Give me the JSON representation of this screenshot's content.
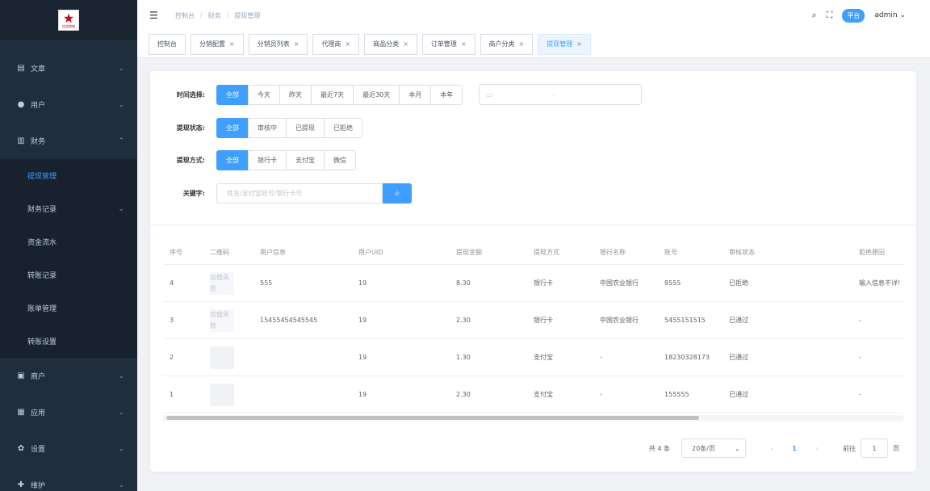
{
  "sidebar": {
    "logo_icon": "star-logo-icon",
    "logo_text": "优选商城",
    "items": [
      {
        "label": "文章",
        "icon": "document-icon"
      },
      {
        "label": "用户",
        "icon": "user-icon"
      },
      {
        "label": "财务",
        "icon": "chart-icon"
      },
      {
        "label": "商户",
        "icon": "shop-icon"
      },
      {
        "label": "应用",
        "icon": "app-icon"
      },
      {
        "label": "设置",
        "icon": "gear-icon"
      },
      {
        "label": "维护",
        "icon": "maintenance-icon"
      }
    ],
    "finance_sub": [
      "提现管理",
      "财务记录",
      "资金流水",
      "转账记录",
      "账单管理",
      "转账设置"
    ],
    "active_sub": "提现管理"
  },
  "header": {
    "breadcrumb": [
      "控制台",
      "财务",
      "提现管理"
    ],
    "platform_badge": "平台",
    "user": "admin"
  },
  "tags": [
    "控制台",
    "分销配置",
    "分销员列表",
    "代理商",
    "商品分类",
    "订单管理",
    "商户分类",
    "提现管理"
  ],
  "filters": {
    "time_label": "时间选择:",
    "time_options": [
      "全部",
      "今天",
      "昨天",
      "最近7天",
      "最近30天",
      "本月",
      "本年"
    ],
    "status_label": "提现状态:",
    "status_options": [
      "全部",
      "审核中",
      "已提现",
      "已拒绝"
    ],
    "method_label": "提现方式:",
    "method_options": [
      "全部",
      "银行卡",
      "支付宝",
      "微信"
    ],
    "keyword_label": "关键字:",
    "keyword_placeholder": "姓名/支付宝账号/银行卡号",
    "date_separator": "-"
  },
  "table": {
    "headers": [
      "序号",
      "二维码",
      "用户信息",
      "用户UID",
      "提现金额",
      "提现方式",
      "银行名称",
      "账号",
      "审核状态",
      "拒绝原因"
    ],
    "rows": [
      {
        "id": "4",
        "qr": "加载失败",
        "user": "555",
        "uid": "19",
        "amount": "8.30",
        "method": "银行卡",
        "bank": "中国农业银行",
        "account": "8555",
        "status": "已拒绝",
        "reason": "输入信息不详!"
      },
      {
        "id": "3",
        "qr": "加载失败",
        "user": "15455454545545",
        "uid": "19",
        "amount": "2.30",
        "method": "银行卡",
        "bank": "中国农业银行",
        "account": "5455151515",
        "status": "已通过",
        "reason": "-"
      },
      {
        "id": "2",
        "qr": "",
        "user": "",
        "uid": "19",
        "amount": "1.30",
        "method": "支付宝",
        "bank": "-",
        "account": "18230328173",
        "status": "已通过",
        "reason": "-"
      },
      {
        "id": "1",
        "qr": "",
        "user": "",
        "uid": "19",
        "amount": "2.30",
        "method": "支付宝",
        "bank": "-",
        "account": "155555",
        "status": "已通过",
        "reason": "-"
      }
    ]
  },
  "pagination": {
    "total": "共 4 条",
    "page_size": "20条/页",
    "current": "1",
    "goto_label": "前往",
    "goto_value": "1",
    "page_suffix": "页"
  }
}
